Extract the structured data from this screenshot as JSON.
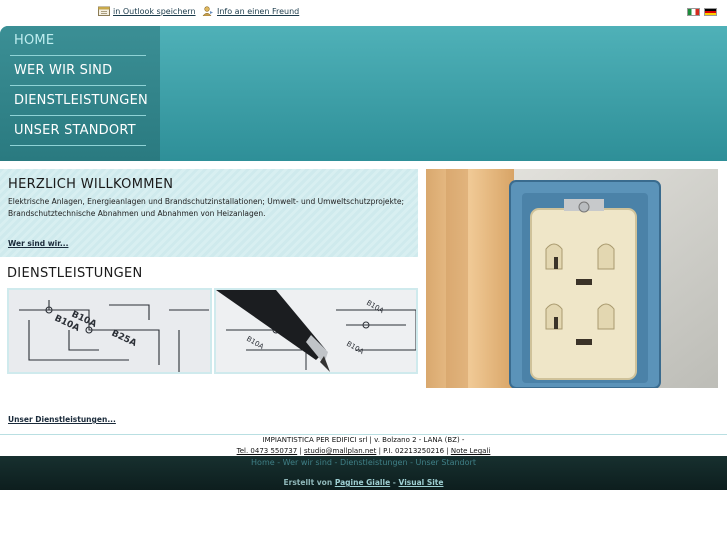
{
  "topbar": {
    "outlook_label": "in Outlook speichern",
    "friend_label": "Info an einen Freund"
  },
  "nav": {
    "items": [
      {
        "label": "HOME"
      },
      {
        "label": "WER WIR SIND"
      },
      {
        "label": "DIENSTLEISTUNGEN"
      },
      {
        "label": "UNSER STANDORT"
      }
    ]
  },
  "welcome": {
    "title": "HERZLICH WILLKOMMEN",
    "text": "Elektrische Anlagen, Energieanlagen und Brandschutzinstallationen; Umwelt- und Umweltschutzprojekte; Brandschutztechnische Abnahmen und Abnahmen von Heizanlagen.",
    "link": "Wer sind wir..."
  },
  "services": {
    "title": "DIENSTLEISTUNGEN",
    "link": "Unser Dienstleistungen..."
  },
  "footer": {
    "company": "IMPIANTISTICA PER EDIFICI srl | v. Bolzano 2 - LANA (BZ) -",
    "tel": "Tel. 0473 550737",
    "email": "studio@mallplan.net",
    "vat": "| P.I. 02213250216 |",
    "legal": "Note Legali",
    "nav": [
      "Home",
      "Wer wir sind",
      "Dienstleistungen",
      "Unser Standort"
    ],
    "sep": "-",
    "credits_prefix": "Erstellt von",
    "credits_a": "Pagine Gialle",
    "credits_b": "Visual Site"
  },
  "colors": {
    "header": "#3fa5ad",
    "nav": "#2e8187",
    "welcome_bg": "#d3ecef",
    "footer_dark": "#132726"
  }
}
